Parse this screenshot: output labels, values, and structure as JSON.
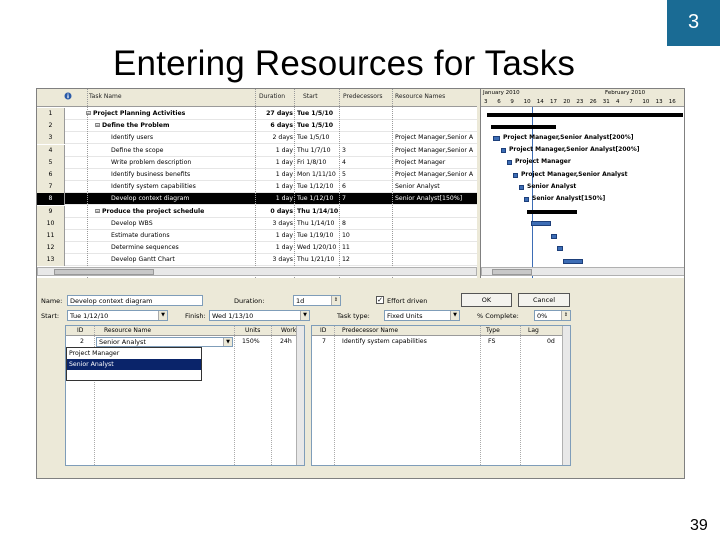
{
  "slide": {
    "number": "3",
    "title": "Entering Resources for Tasks",
    "page": "39"
  },
  "task_table": {
    "columns": [
      "Task Name",
      "Duration",
      "Start",
      "Predecessors",
      "Resource Names"
    ],
    "rows": [
      {
        "id": "1",
        "name": "Project Planning Activities",
        "duration": "27 days",
        "start": "Tue 1/5/10",
        "pred": "",
        "res": "",
        "level": 0,
        "summary": true
      },
      {
        "id": "2",
        "name": "Define the Problem",
        "duration": "6 days",
        "start": "Tue 1/5/10",
        "pred": "",
        "res": "",
        "level": 1,
        "summary": true
      },
      {
        "id": "3",
        "name": "Identify users",
        "duration": "2 days",
        "start": "Tue 1/5/10",
        "pred": "",
        "res": "Project Manager,Senior A",
        "level": 2,
        "summary": false
      },
      {
        "id": "4",
        "name": "Define the scope",
        "duration": "1 day",
        "start": "Thu 1/7/10",
        "pred": "3",
        "res": "Project Manager,Senior A",
        "level": 2,
        "summary": false
      },
      {
        "id": "5",
        "name": "Write problem description",
        "duration": "1 day",
        "start": "Fri 1/8/10",
        "pred": "4",
        "res": "Project Manager",
        "level": 2,
        "summary": false
      },
      {
        "id": "6",
        "name": "Identify business benefits",
        "duration": "1 day",
        "start": "Mon 1/11/10",
        "pred": "5",
        "res": "Project Manager,Senior A",
        "level": 2,
        "summary": false
      },
      {
        "id": "7",
        "name": "Identify system capabilities",
        "duration": "1 day",
        "start": "Tue 1/12/10",
        "pred": "6",
        "res": "Senior Analyst",
        "level": 2,
        "summary": false
      },
      {
        "id": "8",
        "name": "Develop context diagram",
        "duration": "1 day",
        "start": "Tue 1/12/10",
        "pred": "7",
        "res": "Senior Analyst[150%]",
        "level": 2,
        "summary": false,
        "selected": true
      },
      {
        "id": "9",
        "name": "Produce the project schedule",
        "duration": "0 days",
        "start": "Thu 1/14/10",
        "pred": "",
        "res": "",
        "level": 1,
        "summary": true
      },
      {
        "id": "10",
        "name": "Develop WBS",
        "duration": "3 days",
        "start": "Thu 1/14/10",
        "pred": "8",
        "res": "",
        "level": 2,
        "summary": false
      },
      {
        "id": "11",
        "name": "Estimate durations",
        "duration": "1 day",
        "start": "Tue 1/19/10",
        "pred": "10",
        "res": "",
        "level": 2,
        "summary": false
      },
      {
        "id": "12",
        "name": "Determine sequences",
        "duration": "1 day",
        "start": "Wed 1/20/10",
        "pred": "11",
        "res": "",
        "level": 2,
        "summary": false
      },
      {
        "id": "13",
        "name": "Develop Gantt Chart",
        "duration": "3 days",
        "start": "Thu 1/21/10",
        "pred": "12",
        "res": "",
        "level": 2,
        "summary": false
      }
    ]
  },
  "gantt": {
    "months": [
      "January 2010",
      "February 2010"
    ],
    "days": [
      "3",
      "6",
      "9",
      "10",
      "14",
      "17",
      "20",
      "23",
      "26",
      "31",
      "4",
      "7",
      "10",
      "13",
      "16"
    ],
    "labels": [
      "Project Manager,Senior Analyst[200%]",
      "Project Manager,Senior Analyst[200%]",
      "Project Manager",
      "Project Manager,Senior Analyst",
      "Senior Analyst",
      "Senior Analyst[150%]"
    ]
  },
  "form": {
    "name_label": "Name:",
    "name_value": "Develop context diagram",
    "duration_label": "Duration:",
    "duration_value": "1d",
    "effort_driven_label": "Effort driven",
    "ok_label": "OK",
    "cancel_label": "Cancel",
    "start_label": "Start:",
    "start_value": "Tue 1/12/10",
    "finish_label": "Finish:",
    "finish_value": "Wed 1/13/10",
    "task_type_label": "Task type:",
    "task_type_value": "Fixed Units",
    "complete_label": "% Complete:",
    "complete_value": "0%"
  },
  "resource_grid": {
    "columns": [
      "ID",
      "Resource Name",
      "Units",
      "Work"
    ],
    "rows": [
      {
        "id": "2",
        "name": "Senior Analyst",
        "units": "150%",
        "work": "24h"
      }
    ],
    "dropdown_options": [
      "Project Manager",
      "Senior Analyst"
    ],
    "dropdown_selected": "Senior Analyst"
  },
  "predecessor_grid": {
    "columns": [
      "ID",
      "Predecessor Name",
      "Type",
      "Lag"
    ],
    "rows": [
      {
        "id": "7",
        "name": "Identify system capabilities",
        "type": "FS",
        "lag": "0d"
      }
    ]
  }
}
